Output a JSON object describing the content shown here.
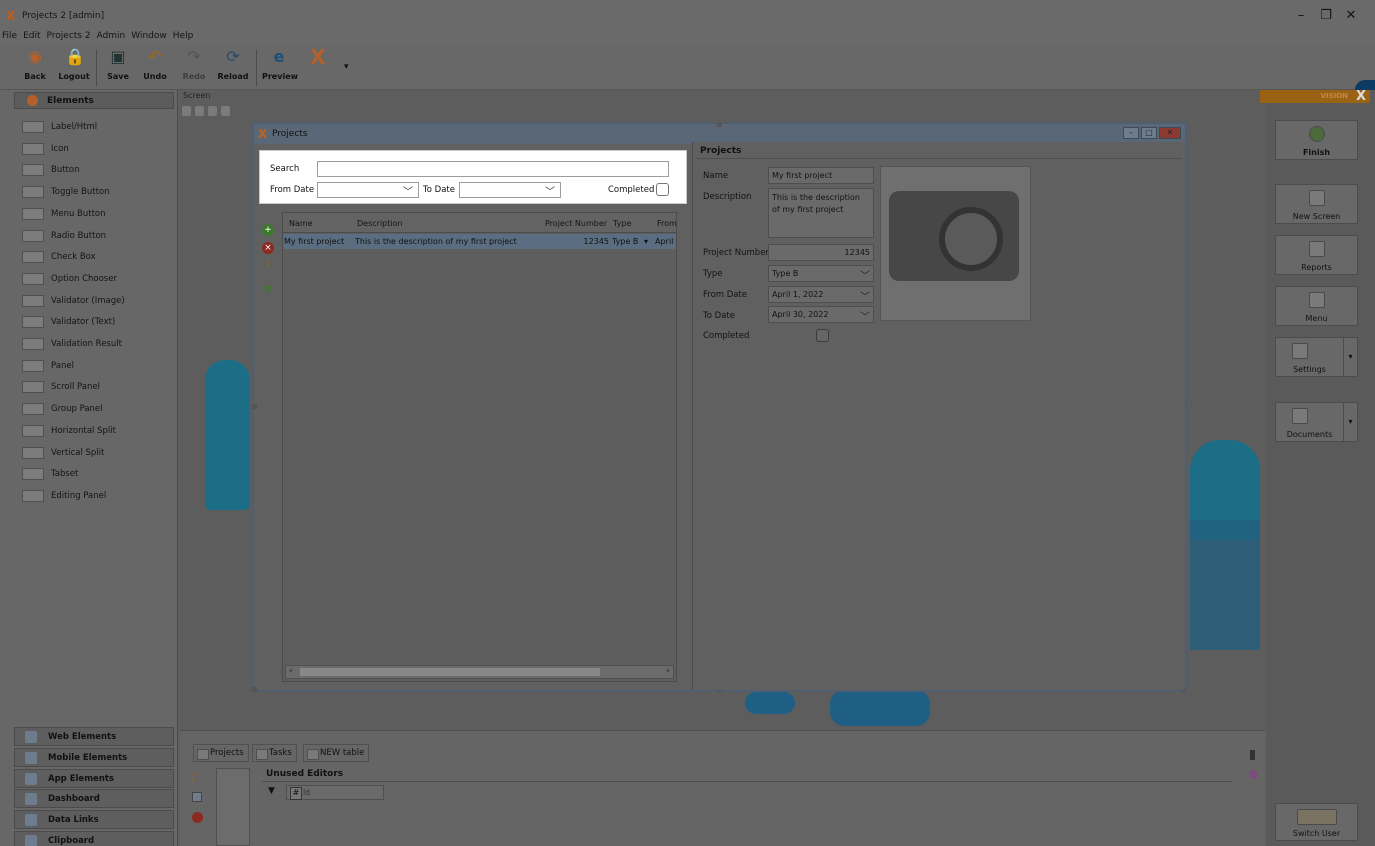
{
  "window": {
    "title": "Projects 2 [admin]",
    "minimize": "–",
    "restore": "❐",
    "close": "✕"
  },
  "menu": [
    "File",
    "Edit",
    "Projects 2",
    "Admin",
    "Window",
    "Help"
  ],
  "toolbar": {
    "back": "Back",
    "logout": "Logout",
    "save": "Save",
    "undo": "Undo",
    "redo": "Redo",
    "reload": "Reload",
    "preview": "Preview",
    "dropdown": "▾"
  },
  "sidebar": {
    "header": "Elements",
    "items": [
      "Label/Html",
      "Icon",
      "Button",
      "Toggle Button",
      "Menu Button",
      "Radio Button",
      "Check Box",
      "Option Chooser",
      "Validator (Image)",
      "Validator (Text)",
      "Validation Result",
      "Panel",
      "Scroll Panel",
      "Group Panel",
      "Horizontal Split",
      "Vertical Split",
      "Tabset",
      "Editing Panel"
    ],
    "sections": [
      "Web Elements",
      "Mobile Elements",
      "App Elements",
      "Dashboard",
      "Data Links",
      "Clipboard"
    ]
  },
  "canvas": {
    "screen_tab": "Screen"
  },
  "projects_window": {
    "title": "Projects",
    "search": {
      "search_label": "Search",
      "search_value": "",
      "from_date_label": "From Date",
      "to_date_label": "To Date",
      "completed_label": "Completed"
    },
    "grid": {
      "columns": [
        "Name",
        "Description",
        "Project Number",
        "Type",
        "From"
      ],
      "rows": [
        {
          "name": "My first project",
          "description": "This is the description of my first project",
          "project_number": "12345",
          "type": "Type B",
          "from": "April"
        }
      ]
    },
    "detail": {
      "title": "Projects",
      "name_label": "Name",
      "name_value": "My first project",
      "description_label": "Description",
      "description_value": "This is the description of my first project",
      "project_number_label": "Project Number",
      "project_number_value": "12345",
      "type_label": "Type",
      "type_value": "Type B",
      "from_date_label": "From Date",
      "from_date_value": "April 1, 2022",
      "to_date_label": "To Date",
      "to_date_value": "April 30, 2022",
      "completed_label": "Completed"
    }
  },
  "bottom": {
    "tabs": [
      "Projects",
      "Tasks",
      "NEW table"
    ],
    "unused_editors": "Unused Editors",
    "id_field": "Id"
  },
  "right_panel": {
    "brand": "VISION",
    "brand_x": "X",
    "buttons": [
      "Finish",
      "New Screen",
      "Reports",
      "Menu",
      "Settings",
      "Documents"
    ],
    "switch_user": "Switch User"
  },
  "colors": {
    "accent": "#c6611c",
    "selection": "#5b6d80",
    "brand_bar": "#9a6314"
  }
}
